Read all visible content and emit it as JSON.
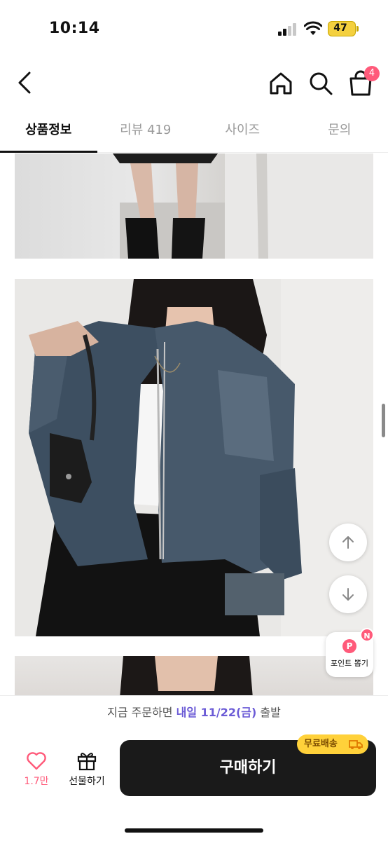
{
  "status_bar": {
    "time": "10:14",
    "battery": "47"
  },
  "nav": {
    "cart_count": "4"
  },
  "tabs": [
    {
      "label": "상품정보",
      "active": true
    },
    {
      "label": "리뷰 419",
      "active": false
    },
    {
      "label": "사이즈",
      "active": false
    },
    {
      "label": "문의",
      "active": false
    }
  ],
  "point_widget": {
    "p": "P",
    "n": "N",
    "label": "포인트 뽑기"
  },
  "shipping_note": {
    "prefix": "지금 주문하면 ",
    "highlight": "내일 11/22(금)",
    "suffix": " 출발"
  },
  "action_bar": {
    "like_count": "1.7만",
    "gift_label": "선물하기",
    "buy_label": "구매하기",
    "free_shipping_label": "무료배송"
  },
  "colors": {
    "accent_pink": "#ff5a7a",
    "highlight_purple": "#6b5bd6",
    "buy_button": "#1a1a1a",
    "free_ship_yellow": "#ffd13a"
  }
}
